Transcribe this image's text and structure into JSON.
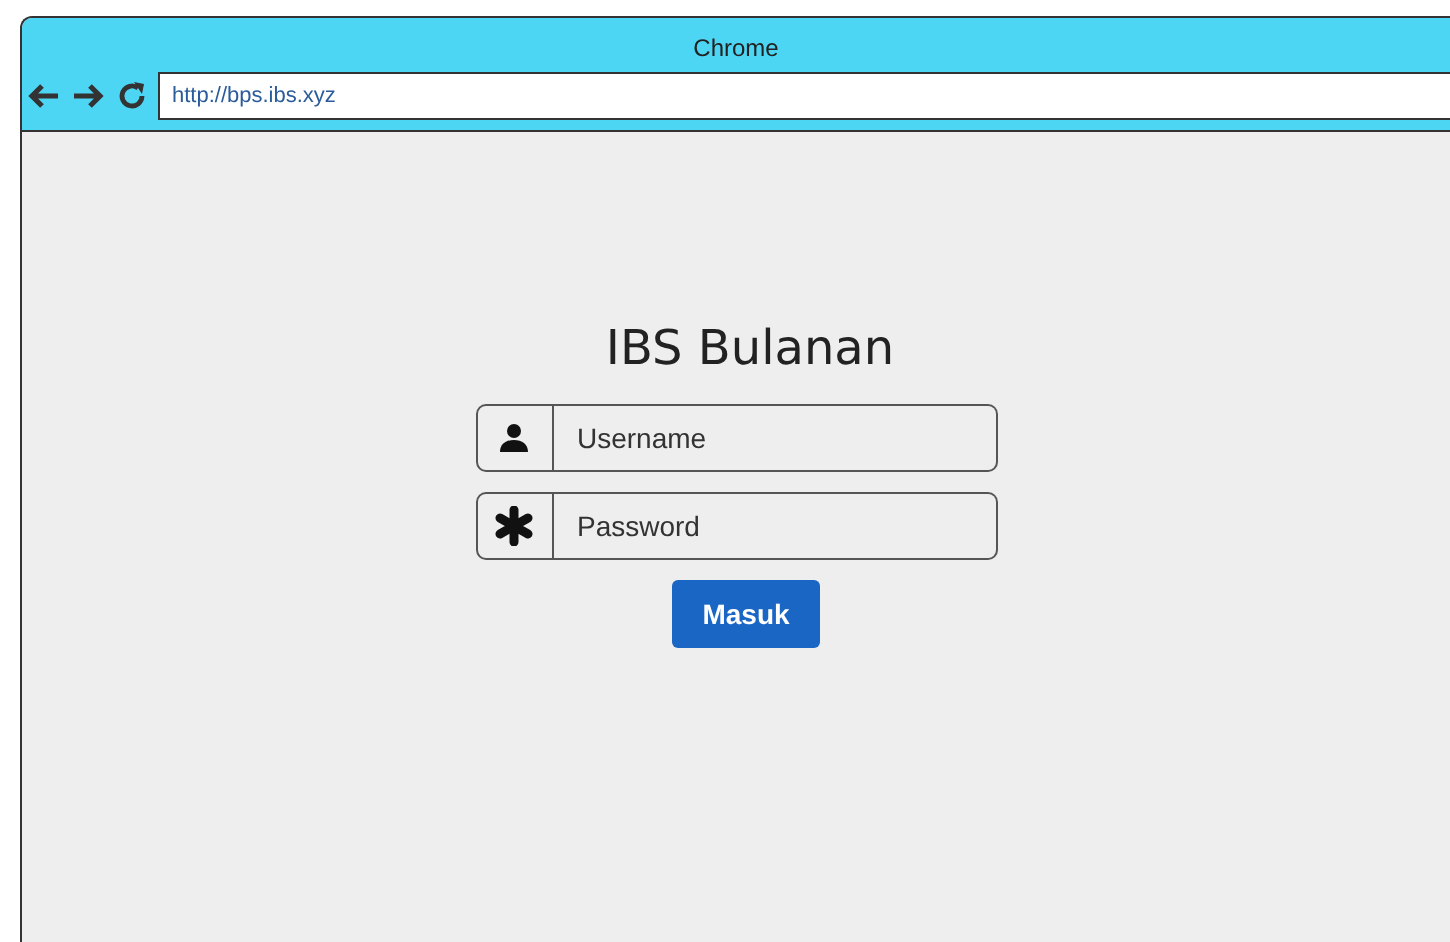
{
  "window": {
    "title": "Chrome"
  },
  "address_bar": {
    "value": "http://bps.ibs.xyz"
  },
  "login": {
    "heading": "IBS Bulanan",
    "fields": [
      {
        "kind": "user",
        "placeholder": "Username"
      },
      {
        "kind": "password",
        "placeholder": "Password"
      }
    ],
    "button": "Masuk"
  }
}
